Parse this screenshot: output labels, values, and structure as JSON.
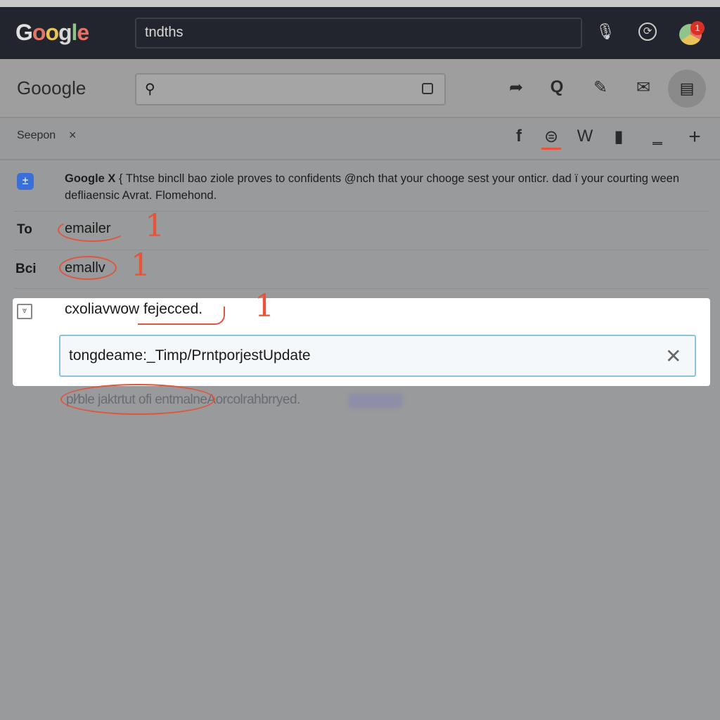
{
  "topbar": {
    "logo": "Google",
    "search_value": "tndths",
    "notification_count": "1"
  },
  "toolbar": {
    "logo": "Gooogle",
    "search_placeholder": ""
  },
  "tab": {
    "label": "Seepon",
    "close": "×"
  },
  "tab_icons": [
    "f",
    "globe",
    "W",
    "doc",
    "minus",
    "+"
  ],
  "notice": {
    "title": "Google X",
    "text": "{ Thtse bincll bao ziole proves to confidents @nch that your chooge sest your onticr. dad ï your courting ween defliaensic Avrat. Flomehond."
  },
  "to": {
    "label": "To",
    "value": "emailer",
    "mark": "1"
  },
  "bcc": {
    "label": "Bci",
    "value": "emallv",
    "mark": "1"
  },
  "subject": {
    "text": "cxoliavwow fejecced.",
    "mark": "1"
  },
  "attachment_field": {
    "value": "tongdeame:_Timp/PrntporjestUpdate"
  },
  "footer_hint": "pl⁄ble jaktrtut ofi entmalneAorcolrahbrryed.",
  "colors": {
    "accent": "#e8533a",
    "topbar": "#22252d",
    "field_border": "#8cc3dc"
  }
}
